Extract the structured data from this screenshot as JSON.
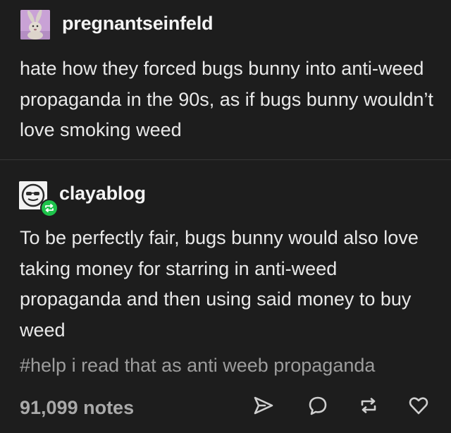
{
  "posts": [
    {
      "username": "pregnantseinfeld",
      "avatar_icon": "bunny-avatar-icon",
      "text": "hate how they forced bugs bunny into anti-weed propaganda in the 90s, as if bugs bunny wouldn’t love smoking weed"
    },
    {
      "username": "clayablog",
      "avatar_icon": "sunglasses-face-avatar-icon",
      "badge_icon": "reblog-badge-icon",
      "text": "To be perfectly fair, bugs bunny would also love taking money for starring in anti-weed propaganda and then using said money to buy weed",
      "tags": "#help i read that as anti weeb propaganda"
    }
  ],
  "footer": {
    "notes": "91,099 notes",
    "actions": [
      {
        "icon": "share-icon"
      },
      {
        "icon": "reply-icon"
      },
      {
        "icon": "reblog-icon"
      },
      {
        "icon": "like-heart-icon"
      }
    ]
  },
  "colors": {
    "background": "#1d1d1d",
    "text": "#e9e9e9",
    "muted": "#9d9d9d",
    "reblog_green": "#1ec34b"
  }
}
